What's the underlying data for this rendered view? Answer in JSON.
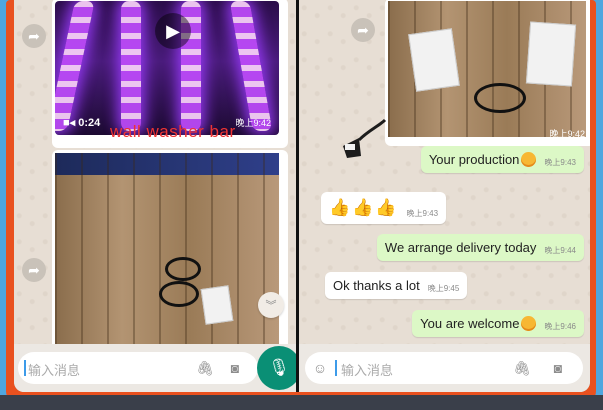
{
  "left_pane": {
    "video": {
      "duration": "0:24",
      "time": "晚上9:42"
    },
    "overlay_label": "wall washer bar"
  },
  "right_pane": {
    "photo": {
      "time": "晚上9:42"
    },
    "messages": [
      {
        "kind": "out",
        "text": "Your production",
        "emoji": "smiley-emoji",
        "time": "晚上9:43"
      },
      {
        "kind": "in",
        "text": "👍👍👍",
        "time": "晚上9:43"
      },
      {
        "kind": "out",
        "text": "We arrange delivery today",
        "time": "晚上9:44"
      },
      {
        "kind": "in",
        "text": "Ok thanks a lot",
        "time": "晚上9:45"
      },
      {
        "kind": "out",
        "text": "You are welcome",
        "emoji": "smiley-emoji",
        "time": "晚上9:46"
      }
    ]
  },
  "input": {
    "placeholder": "输入消息"
  },
  "icons": {
    "forward": "forward-icon",
    "play": "play-icon",
    "video_camera": "video-camera-icon",
    "scroll_down": "double-chevron-down-icon",
    "attach": "paperclip-icon",
    "camera": "camera-icon",
    "mic": "microphone-icon",
    "emoji": "emoji-icon"
  },
  "colors": {
    "frame": "#e9511f",
    "background": "#4fa6df",
    "outgoing_bubble": "#dcf8c6",
    "incoming_bubble": "#ffffff",
    "mic_button": "#0a8f75",
    "overlay_label": "#ee3333"
  }
}
